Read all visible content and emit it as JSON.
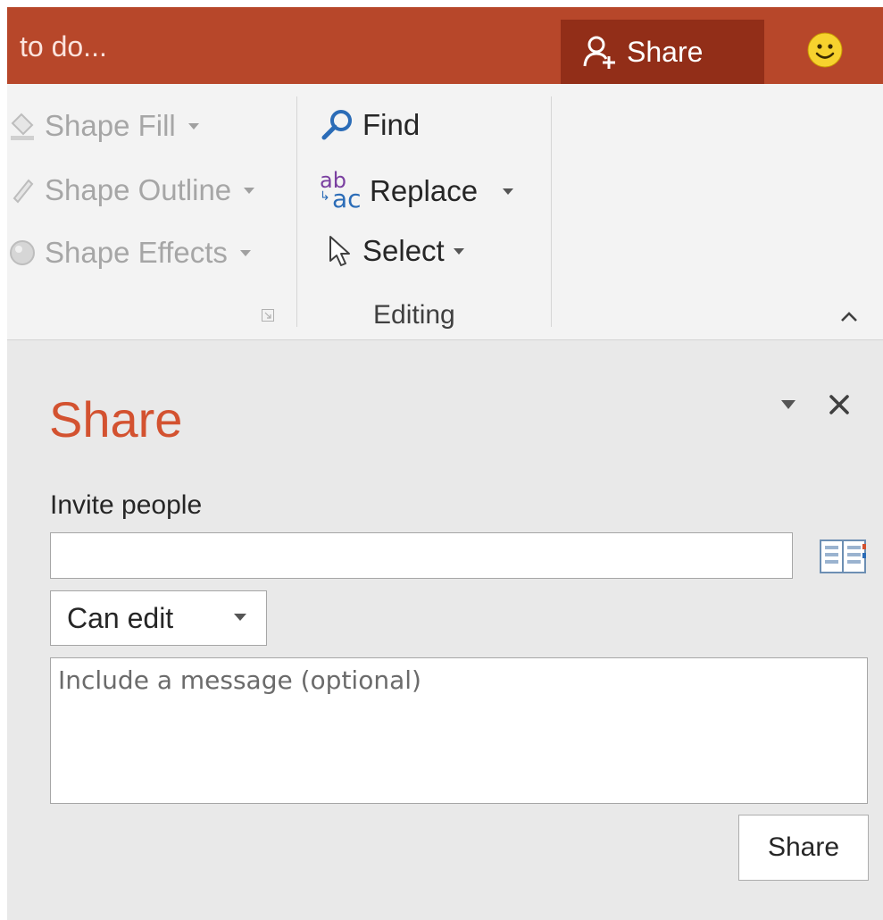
{
  "titlebar": {
    "tell_me_text": "to do...",
    "share_label": "Share",
    "accent_color": "#b7472a"
  },
  "ribbon": {
    "drawing": {
      "shape_fill": "Shape Fill",
      "shape_outline": "Shape Outline",
      "shape_effects": "Shape Effects"
    },
    "editing": {
      "find": "Find",
      "replace": "Replace",
      "select": "Select",
      "group_label": "Editing"
    }
  },
  "share_pane": {
    "title": "Share",
    "invite_label": "Invite people",
    "invite_value": "",
    "permission": "Can edit",
    "message_placeholder": "Include a message (optional)",
    "share_button": "Share",
    "title_color": "#d35230"
  },
  "icons": {
    "share_top": "person-add-icon",
    "feedback": "smiley-icon",
    "find": "search-icon",
    "replace": "replace-icon",
    "select": "cursor-icon",
    "address_book": "address-book-icon",
    "close": "close-icon",
    "pane_menu": "chevron-down-icon",
    "collapse": "chevron-up-icon"
  }
}
